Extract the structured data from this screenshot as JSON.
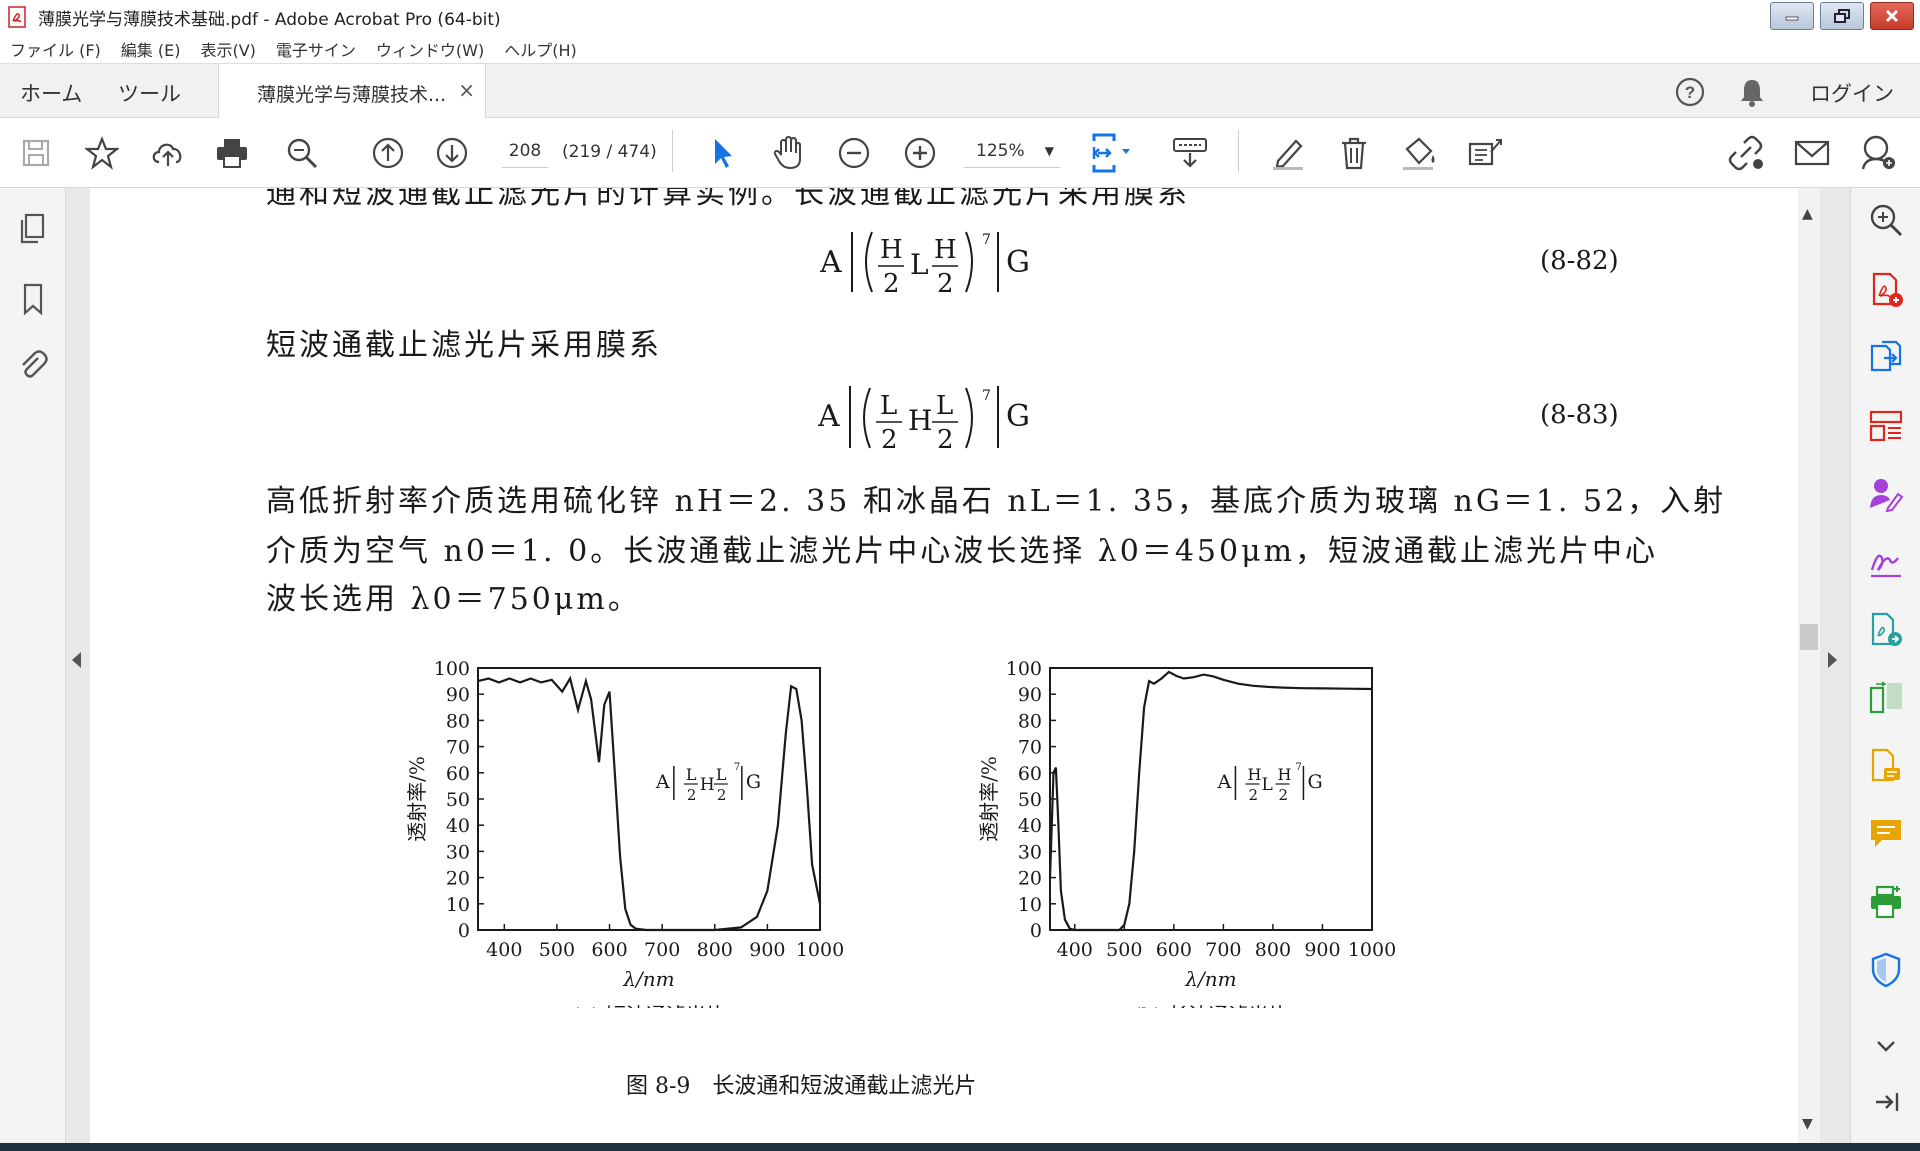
{
  "window": {
    "title": "薄膜光学与薄膜技术基础.pdf - Adobe Acrobat Pro (64-bit)"
  },
  "menu": [
    "ファイル (F)",
    "編集 (E)",
    "表示(V)",
    "電子サイン",
    "ウィンドウ(W)",
    "ヘルプ(H)"
  ],
  "tabs": {
    "home": "ホーム",
    "tools": "ツール",
    "document": "薄膜光学与薄膜技术...",
    "close": "×",
    "login": "ログイン"
  },
  "toolbar": {
    "page_number": "208",
    "page_count": "(219 / 474)",
    "zoom": "125%"
  },
  "document": {
    "cut_line": "通和短波通截止滤光片的计算实例。长波通截止滤光片采用膜系",
    "eq1_number": "(8-82)",
    "line2": "短波通截止滤光片采用膜系",
    "eq2_number": "(8-83)",
    "para_line1": "高低折射率介质选用硫化锌 nH＝2. 35 和冰晶石 nL＝1. 35，基底介质为玻璃 nG＝1. 52，入射",
    "para_line2": "介质为空气 n0＝1. 0。长波通截止滤光片中心波长选择 λ0＝450μm，短波通截止滤光片中心",
    "para_line3": "波长选用 λ0＝750μm。",
    "figure_caption": "图 8-9　长波通和短波通截止滤光片"
  },
  "chart_data": [
    {
      "type": "line",
      "caption": "(a) 短波通滤光片",
      "xlabel": "λ/nm",
      "ylabel": "透射率/%",
      "xlim": [
        350,
        1000
      ],
      "ylim": [
        0,
        100
      ],
      "xticks": [
        400,
        500,
        600,
        700,
        800,
        900,
        1000
      ],
      "yticks": [
        0,
        10,
        20,
        30,
        40,
        50,
        60,
        70,
        80,
        90,
        100
      ],
      "x": [
        350,
        370,
        390,
        410,
        430,
        450,
        470,
        490,
        510,
        525,
        540,
        555,
        565,
        580,
        590,
        600,
        610,
        620,
        630,
        640,
        650,
        670,
        700,
        750,
        800,
        850,
        880,
        900,
        920,
        935,
        945,
        955,
        965,
        975,
        985,
        1000
      ],
      "y": [
        95,
        96,
        94.5,
        96,
        94.5,
        96,
        94.5,
        95.5,
        91,
        96,
        84,
        95,
        88,
        64,
        86,
        91,
        60,
        28,
        8,
        2,
        0.5,
        0,
        0,
        0,
        0,
        1,
        5,
        15,
        40,
        75,
        93,
        92,
        80,
        55,
        25,
        10
      ]
    },
    {
      "type": "line",
      "caption": "(b) 长波通滤光片",
      "xlabel": "λ/nm",
      "ylabel": "透射率/%",
      "xlim": [
        350,
        1000
      ],
      "ylim": [
        0,
        100
      ],
      "xticks": [
        400,
        500,
        600,
        700,
        800,
        900,
        1000
      ],
      "yticks": [
        0,
        10,
        20,
        30,
        40,
        50,
        60,
        70,
        80,
        90,
        100
      ],
      "x": [
        350,
        357,
        362,
        367,
        372,
        380,
        390,
        400,
        450,
        490,
        500,
        510,
        520,
        530,
        540,
        550,
        560,
        575,
        590,
        605,
        620,
        640,
        660,
        680,
        700,
        730,
        760,
        790,
        820,
        860,
        900,
        950,
        1000
      ],
      "y": [
        20,
        60,
        62,
        40,
        15,
        4,
        0.5,
        0,
        0,
        0,
        2,
        10,
        30,
        60,
        85,
        95,
        94,
        96,
        98.5,
        97,
        96,
        96.5,
        97.5,
        96.8,
        95.5,
        94,
        93.2,
        92.8,
        92.5,
        92.3,
        92.2,
        92.1,
        92
      ]
    }
  ],
  "colors": {
    "accent_blue": "#1473e6",
    "pdf_red": "#e0261b",
    "purple": "#a541d8",
    "green": "#2d9d3a",
    "yellow": "#e8a400"
  }
}
